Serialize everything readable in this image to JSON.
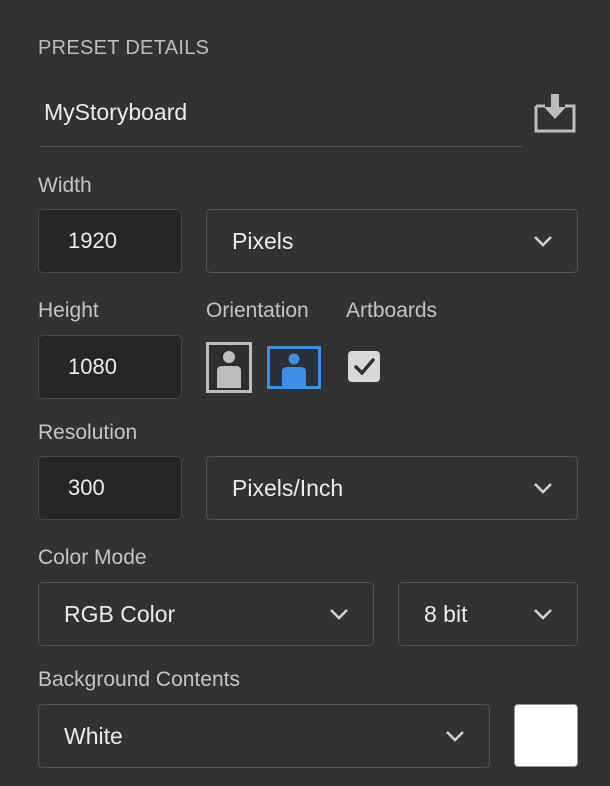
{
  "section_title": "PRESET DETAILS",
  "preset_name": "MyStoryboard",
  "width": {
    "label": "Width",
    "value": "1920",
    "unit": "Pixels"
  },
  "height": {
    "label": "Height",
    "value": "1080"
  },
  "orientation": {
    "label": "Orientation",
    "selected": "landscape",
    "options": [
      "portrait",
      "landscape"
    ]
  },
  "artboards": {
    "label": "Artboards",
    "checked": true
  },
  "resolution": {
    "label": "Resolution",
    "value": "300",
    "unit": "Pixels/Inch"
  },
  "color_mode": {
    "label": "Color Mode",
    "mode": "RGB Color",
    "depth": "8 bit"
  },
  "background": {
    "label": "Background Contents",
    "value": "White",
    "swatch_color": "#ffffff"
  },
  "colors": {
    "panel_bg": "#323232",
    "field_bg": "#262626",
    "accent": "#3d8ee6"
  },
  "icons": {
    "save": "save-preset-icon",
    "dropdown": "chevron-down-icon",
    "check": "checkmark-icon"
  }
}
